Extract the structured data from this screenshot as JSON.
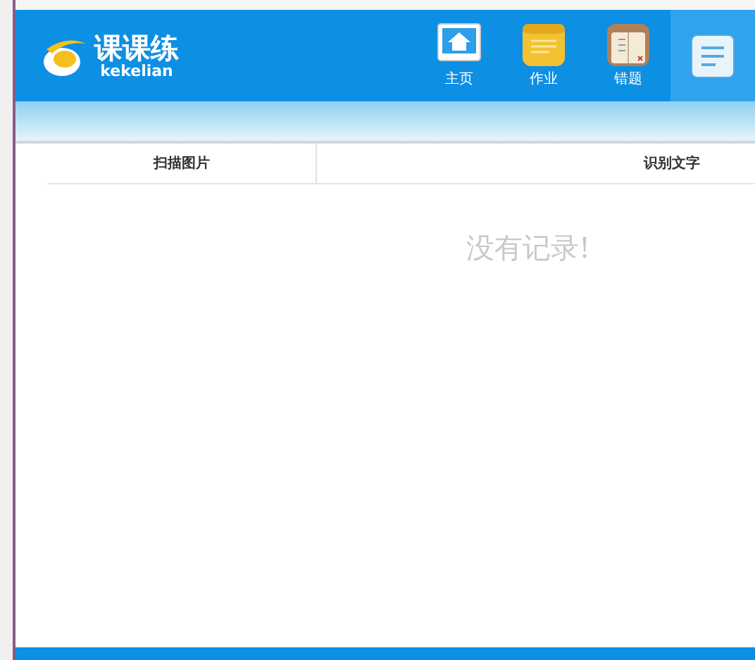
{
  "logo": {
    "title": "课课练",
    "subtitle": "kekelian"
  },
  "nav": [
    {
      "label": "主页",
      "kind": "home",
      "selected": false
    },
    {
      "label": "作业",
      "kind": "notes",
      "selected": false
    },
    {
      "label": "错题",
      "kind": "book",
      "selected": false
    },
    {
      "kind": "scan",
      "selected": true
    }
  ],
  "table": {
    "columns": [
      "扫描图片",
      "识别文字"
    ],
    "empty_message": "没有记录!"
  }
}
